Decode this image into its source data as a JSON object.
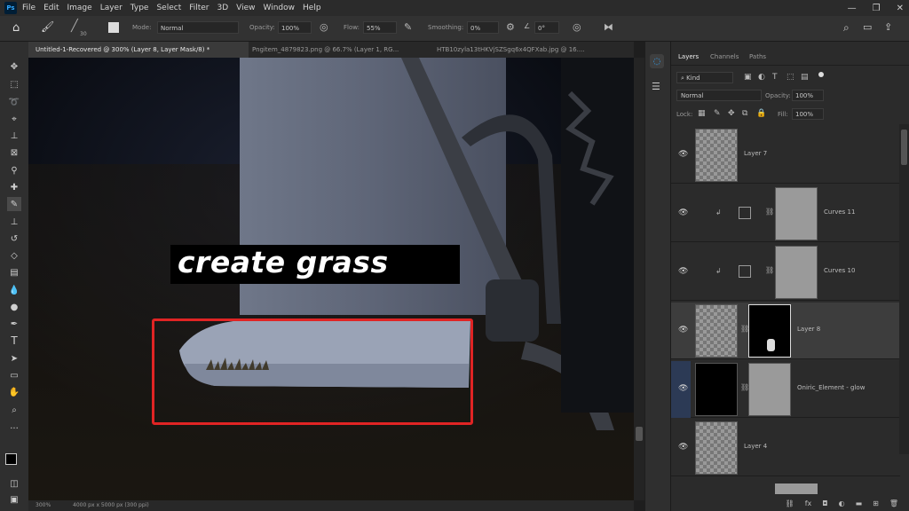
{
  "app": {
    "logo": "Ps"
  },
  "menu": [
    "File",
    "Edit",
    "Image",
    "Layer",
    "Type",
    "Select",
    "Filter",
    "3D",
    "View",
    "Window",
    "Help"
  ],
  "window_controls": [
    "—",
    "❐",
    "✕"
  ],
  "options": {
    "brush_size": "30",
    "mode_label": "Mode:",
    "mode_value": "Normal",
    "opacity_label": "Opacity:",
    "opacity_value": "100%",
    "flow_label": "Flow:",
    "flow_value": "55%",
    "smoothing_label": "Smoothing:",
    "smoothing_value": "0%",
    "angle_value": "0°"
  },
  "tabs": [
    {
      "label": "Untitled-1-Recovered @ 300% (Layer 8, Layer Mask/8) *"
    },
    {
      "label": "Pngitem_4879823.png @ 66.7% (Layer 1, RG..."
    },
    {
      "label": "HTB10zyla13tHKVjSZSgq6x4QFXab.jpg @ 16...."
    }
  ],
  "status": {
    "zoom": "300%",
    "doc": "4000 px x 5000 px (300 ppi)"
  },
  "caption": "create grass",
  "layers_panel": {
    "tabs": [
      "Layers",
      "Channels",
      "Paths"
    ],
    "kind_label": "Kind",
    "blend_mode": "Normal",
    "opacity_label": "Opacity:",
    "opacity_value": "100%",
    "lock_label": "Lock:",
    "fill_label": "Fill:",
    "fill_value": "100%",
    "layers": [
      {
        "name": "Layer 7"
      },
      {
        "name": "Curves 11"
      },
      {
        "name": "Curves 10"
      },
      {
        "name": "Layer 8"
      },
      {
        "name": "Oniric_Element - glow"
      },
      {
        "name": "Layer 4"
      }
    ]
  },
  "colors": {
    "highlight": "#e02424",
    "accent": "#31a8ff"
  }
}
